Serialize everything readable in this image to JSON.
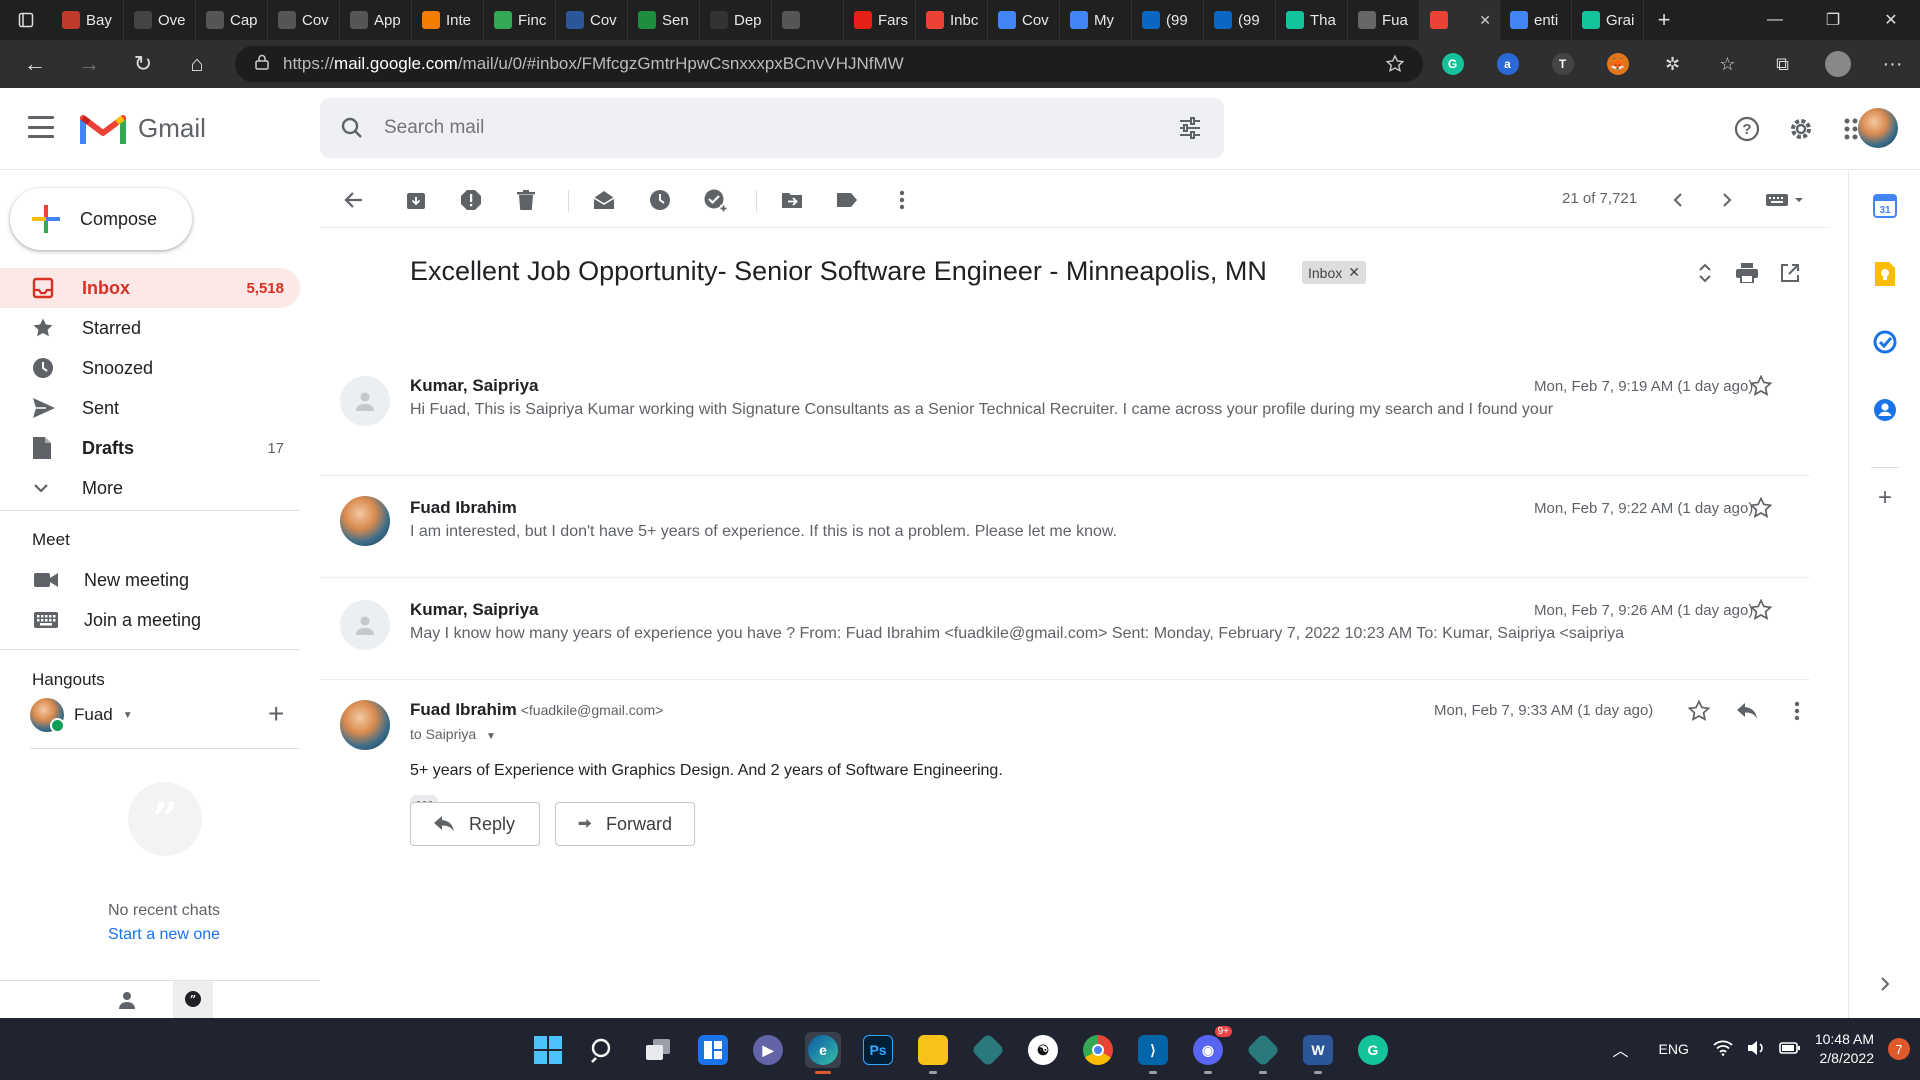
{
  "browser": {
    "tabs": [
      {
        "label": "Bay",
        "color": "#c0392b"
      },
      {
        "label": "Ove",
        "color": "#444"
      },
      {
        "label": "Cap",
        "color": "#555"
      },
      {
        "label": "Cov",
        "color": "#555"
      },
      {
        "label": "App",
        "color": "#555"
      },
      {
        "label": "Inte",
        "color": "#f57c00"
      },
      {
        "label": "Finc",
        "color": "#34a853"
      },
      {
        "label": "Cov",
        "color": "#2b579a"
      },
      {
        "label": "Sen",
        "color": "#1e8e3e"
      },
      {
        "label": "Dep",
        "color": "#333"
      },
      {
        "label": "",
        "color": "#555"
      },
      {
        "label": "Fars",
        "color": "#e62117"
      },
      {
        "label": "Inbc",
        "color": "#ea4335"
      },
      {
        "label": "Cov",
        "color": "#4285f4"
      },
      {
        "label": "My",
        "color": "#4285f4"
      },
      {
        "label": "(99",
        "color": "#0a66c2"
      },
      {
        "label": "(99",
        "color": "#0a66c2"
      },
      {
        "label": "Tha",
        "color": "#15c39a"
      },
      {
        "label": "Fua",
        "color": "#666"
      },
      {
        "label": "",
        "color": "#ea4335",
        "active": true
      },
      {
        "label": "enti",
        "color": "#4285f4"
      },
      {
        "label": "Grai",
        "color": "#15c39a"
      }
    ],
    "url_prefix": "https://",
    "url_host": "mail.google.com",
    "url_path": "/mail/u/0/#inbox/FMfcgzGmtrHpwCsnxxxpxBCnvVHJNfMW"
  },
  "gmail": {
    "app_name": "Gmail",
    "search_placeholder": "Search mail",
    "compose_label": "Compose",
    "nav": [
      {
        "label": "Inbox",
        "count": "5,518",
        "icon": "inbox-icon"
      },
      {
        "label": "Starred",
        "count": "",
        "icon": "star-icon"
      },
      {
        "label": "Snoozed",
        "count": "",
        "icon": "clock-icon"
      },
      {
        "label": "Sent",
        "count": "",
        "icon": "send-icon"
      },
      {
        "label": "Drafts",
        "count": "17",
        "icon": "draft-icon"
      },
      {
        "label": "More",
        "count": "",
        "icon": "chevron-down-icon"
      }
    ],
    "meet": {
      "heading": "Meet",
      "new_meeting": "New meeting",
      "join_meeting": "Join a meeting"
    },
    "hangouts": {
      "heading": "Hangouts",
      "user": "Fuad",
      "no_chats": "No recent chats",
      "start_new": "Start a new one"
    },
    "pager": "21 of 7,721",
    "thread": {
      "subject": "Excellent Job Opportunity- Senior Software Engineer - Minneapolis, MN",
      "label_chip": "Inbox",
      "messages": [
        {
          "sender": "Kumar, Saipriya",
          "date": "Mon, Feb 7, 9:19 AM (1 day ago)",
          "snippet": "Hi Fuad, This is Saipriya Kumar working with Signature Consultants as a Senior Technical Recruiter. I came across your profile during my search and I found your"
        },
        {
          "sender": "Fuad Ibrahim",
          "date": "Mon, Feb 7, 9:22 AM (1 day ago)",
          "snippet": "I am interested, but I don't have 5+ years of experience. If this is not a problem. Please let me know."
        },
        {
          "sender": "Kumar, Saipriya",
          "date": "Mon, Feb 7, 9:26 AM (1 day ago)",
          "snippet": "May I know how many years of experience you have ? From: Fuad Ibrahim <fuadkile@gmail.com> Sent: Monday, February 7, 2022 10:23 AM To: Kumar, Saipriya <saipriya"
        }
      ],
      "expanded": {
        "sender": "Fuad Ibrahim",
        "email": "<fuadkile@gmail.com>",
        "to": "to Saipriya",
        "date": "Mon, Feb 7, 9:33 AM (1 day ago)",
        "body": "5+ years of Experience with Graphics Design. And 2 years of Software Engineering."
      },
      "reply_label": "Reply",
      "forward_label": "Forward"
    }
  },
  "taskbar": {
    "language": "ENG",
    "time": "10:48 AM",
    "date": "2/8/2022",
    "notifications": "7",
    "discord_badge": "9+"
  }
}
